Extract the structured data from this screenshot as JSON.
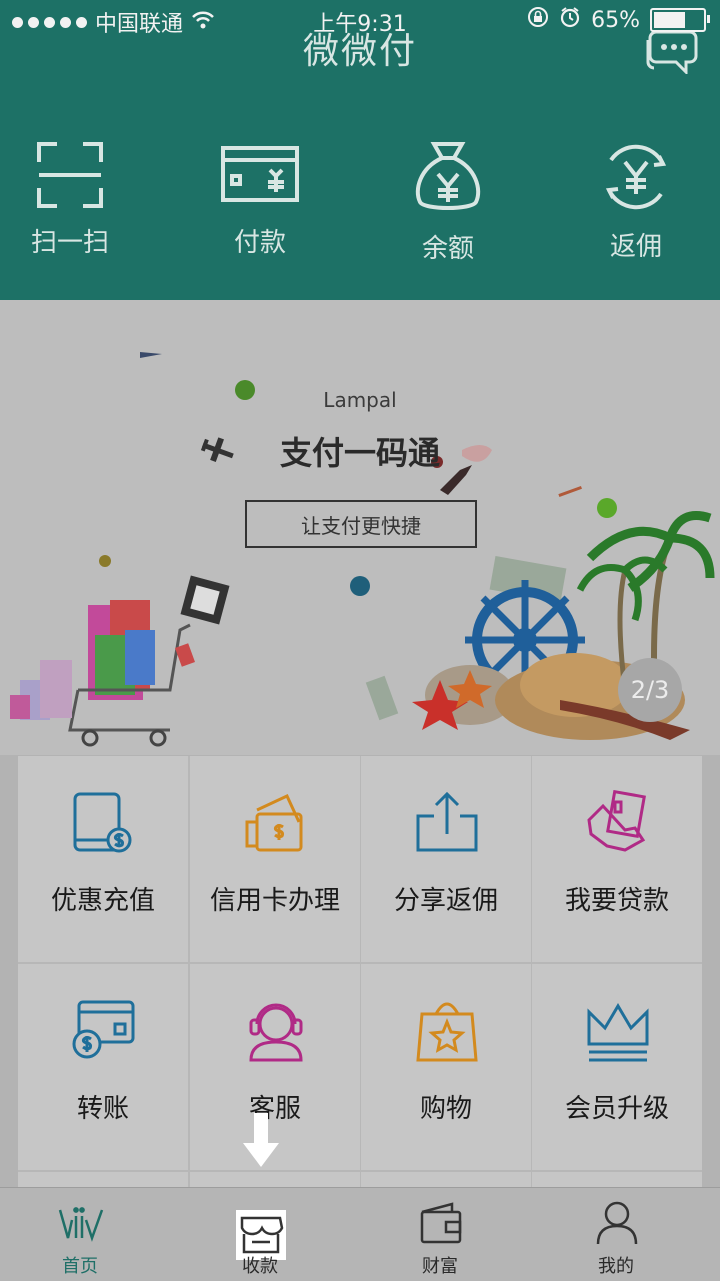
{
  "status_bar": {
    "carrier": "中国联通",
    "time": "上午9:31",
    "battery_percent": "65%",
    "battery_level": 0.65,
    "icons": [
      "signal-dots",
      "wifi-icon",
      "orientation-lock-icon",
      "alarm-icon",
      "battery-icon"
    ]
  },
  "header": {
    "title": "微微付",
    "chat_icon": "chat-bubble-icon",
    "quick_actions": [
      {
        "label": "扫一扫",
        "icon": "scan-icon"
      },
      {
        "label": "付款",
        "icon": "payment-card-icon"
      },
      {
        "label": "余额",
        "icon": "money-bag-icon"
      },
      {
        "label": "返佣",
        "icon": "yen-circle-icon"
      }
    ]
  },
  "banner": {
    "brand": "Lampal",
    "headline": "支付一码通",
    "cta": "让支付更快捷",
    "page_indicator": "2/3"
  },
  "grid": {
    "items": [
      {
        "label": "优惠充值",
        "icon": "tablet-recharge-icon"
      },
      {
        "label": "信用卡办理",
        "icon": "credit-card-wallet-icon"
      },
      {
        "label": "分享返佣",
        "icon": "share-upload-icon"
      },
      {
        "label": "我要贷款",
        "icon": "loan-hand-icon"
      },
      {
        "label": "转账",
        "icon": "transfer-card-icon"
      },
      {
        "label": "客服",
        "icon": "customer-service-icon"
      },
      {
        "label": "购物",
        "icon": "shopping-bag-icon"
      },
      {
        "label": "会员升级",
        "icon": "crown-icon"
      }
    ]
  },
  "tab_bar": {
    "tabs": [
      {
        "label": "首页",
        "icon": "home-logo-icon",
        "active": true
      },
      {
        "label": "收款",
        "icon": "store-icon",
        "active": false
      },
      {
        "label": "财富",
        "icon": "wallet-icon",
        "active": false
      },
      {
        "label": "我的",
        "icon": "user-icon",
        "active": false
      }
    ]
  },
  "colors": {
    "header_bg": "#1d7166",
    "accent_blue": "#1f6f9a",
    "accent_orange": "#d38a1e",
    "accent_magenta": "#b02a86"
  }
}
